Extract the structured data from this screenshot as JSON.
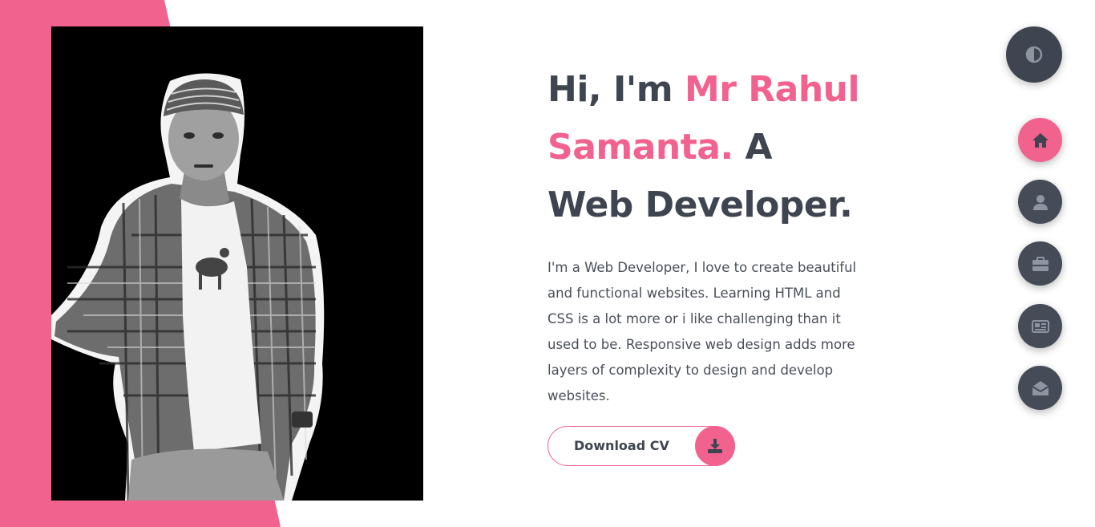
{
  "colors": {
    "accent": "#f2628f",
    "dark": "#3f4550",
    "nav_bg": "#454c57",
    "photo_bg": "#000000",
    "page_bg": "#ffffff"
  },
  "hero": {
    "greeting": "Hi, I'm ",
    "name": "Mr Rahul Samanta.",
    "role_prefix": " A",
    "role": "Web Developer.",
    "bio": "I'm a Web Developer, I love to create beautiful and functional websites. Learning HTML and CSS is a lot more or i like challenging than it used to be. Responsive web design adds more layers of complexity to design and develop websites.",
    "cta_label": "Download CV",
    "cta_icon": "download-icon"
  },
  "profile_photo": {
    "description_icon": "profile-photo"
  },
  "theme_toggle": {
    "icon": "contrast-icon"
  },
  "side_nav": {
    "items": [
      {
        "id": "home",
        "icon": "home-icon",
        "active": true
      },
      {
        "id": "about",
        "icon": "user-icon",
        "active": false
      },
      {
        "id": "portfolio",
        "icon": "briefcase-icon",
        "active": false
      },
      {
        "id": "blogs",
        "icon": "newspaper-icon",
        "active": false
      },
      {
        "id": "contact",
        "icon": "envelope-open-icon",
        "active": false
      }
    ]
  }
}
